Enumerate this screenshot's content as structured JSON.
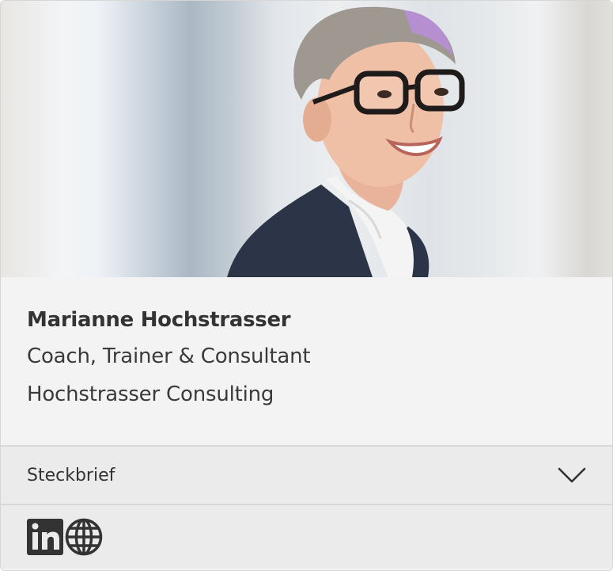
{
  "profile": {
    "name": "Marianne Hochstrasser",
    "role": "Coach, Trainer & Consultant",
    "company": "Hochstrasser Consulting"
  },
  "accordion": {
    "label": "Steckbrief",
    "icon": "chevron-down-icon",
    "expanded": false
  },
  "social": {
    "links": [
      {
        "icon": "linkedin-icon",
        "text": "in"
      },
      {
        "icon": "globe-icon"
      }
    ]
  },
  "colors": {
    "card_background": "#f3f3f3",
    "accordion_background": "#ebebeb",
    "text": "#333333",
    "icon": "#333333"
  }
}
